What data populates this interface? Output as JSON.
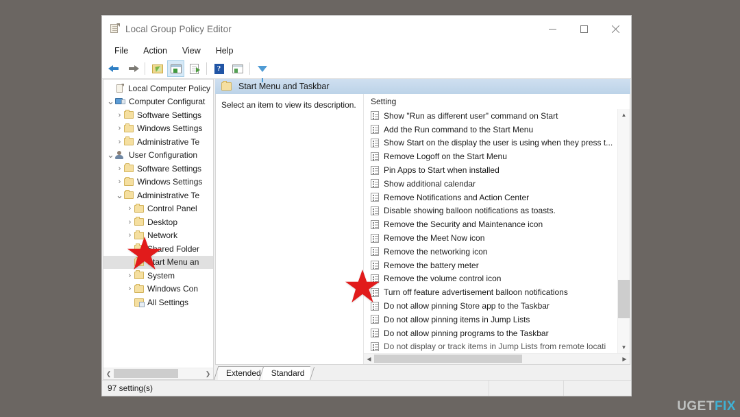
{
  "window": {
    "title": "Local Group Policy Editor",
    "title_icon": "policy-document-icon",
    "minimize_label": "Minimize",
    "maximize_label": "Maximize",
    "close_label": "Close"
  },
  "menu": {
    "items": [
      {
        "label": "File"
      },
      {
        "label": "Action"
      },
      {
        "label": "View"
      },
      {
        "label": "Help"
      }
    ]
  },
  "toolbar": {
    "buttons": [
      {
        "name": "back-button",
        "icon": "back-arrow-icon",
        "tip": "Back"
      },
      {
        "name": "forward-button",
        "icon": "forward-arrow-icon",
        "tip": "Forward"
      },
      {
        "name": "up-one-level-button",
        "icon": "folder-up-icon",
        "tip": "Up One Level"
      },
      {
        "name": "show-hide-console-tree-button",
        "icon": "console-tree-icon",
        "tip": "Show/Hide Console Tree"
      },
      {
        "name": "export-list-button",
        "icon": "export-list-icon",
        "tip": "Export List"
      },
      {
        "name": "help-button",
        "icon": "help-question-icon",
        "tip": "Help"
      },
      {
        "name": "properties-button",
        "icon": "properties-window-icon",
        "tip": "Properties"
      },
      {
        "name": "filter-button",
        "icon": "filter-funnel-icon",
        "tip": "Filter Options"
      }
    ]
  },
  "tree": {
    "items": [
      {
        "label": "Local Computer Policy",
        "indent": 1,
        "chevron": "",
        "icon": "policy-root-icon",
        "selected": false
      },
      {
        "label": "Computer Configurat",
        "indent": 1,
        "chevron": "v",
        "icon": "computer-icon",
        "selected": false
      },
      {
        "label": "Software Settings",
        "indent": 2,
        "chevron": ">",
        "icon": "folder-icon",
        "selected": false
      },
      {
        "label": "Windows Settings",
        "indent": 2,
        "chevron": ">",
        "icon": "folder-icon",
        "selected": false
      },
      {
        "label": "Administrative Te",
        "indent": 2,
        "chevron": ">",
        "icon": "folder-icon",
        "selected": false
      },
      {
        "label": "User Configuration",
        "indent": 1,
        "chevron": "v",
        "icon": "user-icon",
        "selected": false
      },
      {
        "label": "Software Settings",
        "indent": 2,
        "chevron": ">",
        "icon": "folder-icon",
        "selected": false
      },
      {
        "label": "Windows Settings",
        "indent": 2,
        "chevron": ">",
        "icon": "folder-icon",
        "selected": false
      },
      {
        "label": "Administrative Te",
        "indent": 2,
        "chevron": "v",
        "icon": "folder-icon",
        "selected": false
      },
      {
        "label": "Control Panel",
        "indent": 3,
        "chevron": ">",
        "icon": "folder-icon",
        "selected": false
      },
      {
        "label": "Desktop",
        "indent": 3,
        "chevron": ">",
        "icon": "folder-icon",
        "selected": false
      },
      {
        "label": "Network",
        "indent": 3,
        "chevron": ">",
        "icon": "folder-icon",
        "selected": false
      },
      {
        "label": "Shared Folder",
        "indent": 3,
        "chevron": "",
        "icon": "folder-icon",
        "selected": false
      },
      {
        "label": "Start Menu an",
        "indent": 3,
        "chevron": "",
        "icon": "folder-icon",
        "selected": true
      },
      {
        "label": "System",
        "indent": 3,
        "chevron": ">",
        "icon": "folder-icon",
        "selected": false
      },
      {
        "label": "Windows Con",
        "indent": 3,
        "chevron": ">",
        "icon": "folder-icon",
        "selected": false
      },
      {
        "label": "All Settings",
        "indent": 3,
        "chevron": "",
        "icon": "all-settings-icon",
        "selected": false
      }
    ]
  },
  "banner": {
    "title": "Start Menu and Taskbar",
    "icon": "folder-icon"
  },
  "description_pane": {
    "text": "Select an item to view its description."
  },
  "list": {
    "column_header": "Setting",
    "rows": [
      {
        "label": "Show \"Run as different user\" command on Start"
      },
      {
        "label": "Add the Run command to the Start Menu"
      },
      {
        "label": "Show Start on the display the user is using when they press t..."
      },
      {
        "label": "Remove Logoff on the Start Menu"
      },
      {
        "label": "Pin Apps to Start when installed"
      },
      {
        "label": "Show additional calendar"
      },
      {
        "label": "Remove Notifications and Action Center"
      },
      {
        "label": "Disable showing balloon notifications as toasts."
      },
      {
        "label": "Remove the Security and Maintenance icon"
      },
      {
        "label": "Remove the Meet Now icon"
      },
      {
        "label": "Remove the networking icon"
      },
      {
        "label": "Remove the battery meter"
      },
      {
        "label": "Remove the volume control icon"
      },
      {
        "label": "Turn off feature advertisement balloon notifications"
      },
      {
        "label": "Do not allow pinning Store app to the Taskbar"
      },
      {
        "label": "Do not allow pinning items in Jump Lists"
      },
      {
        "label": "Do not allow pinning programs to the Taskbar"
      },
      {
        "label": "Do not display or track items in Jump Lists from remote locati"
      }
    ]
  },
  "tabs": [
    {
      "label": "Extended",
      "active": false
    },
    {
      "label": "Standard",
      "active": true
    }
  ],
  "statusbar": {
    "text": "97 setting(s)"
  },
  "annotations": {
    "star_color": "#e11b1b",
    "stars": [
      {
        "name": "star-pointer-tree",
        "target": "Start Menu an"
      },
      {
        "name": "star-pointer-list",
        "target": "Remove the volume control icon"
      }
    ]
  },
  "watermark": {
    "part1": "UG",
    "part2": "ET",
    "part3": "FIX",
    "accent_color": "#3bb9e0"
  },
  "colors": {
    "desktop_background": "#6b6662",
    "banner": "#c3d7ea",
    "selection": "#e0e0e0"
  }
}
